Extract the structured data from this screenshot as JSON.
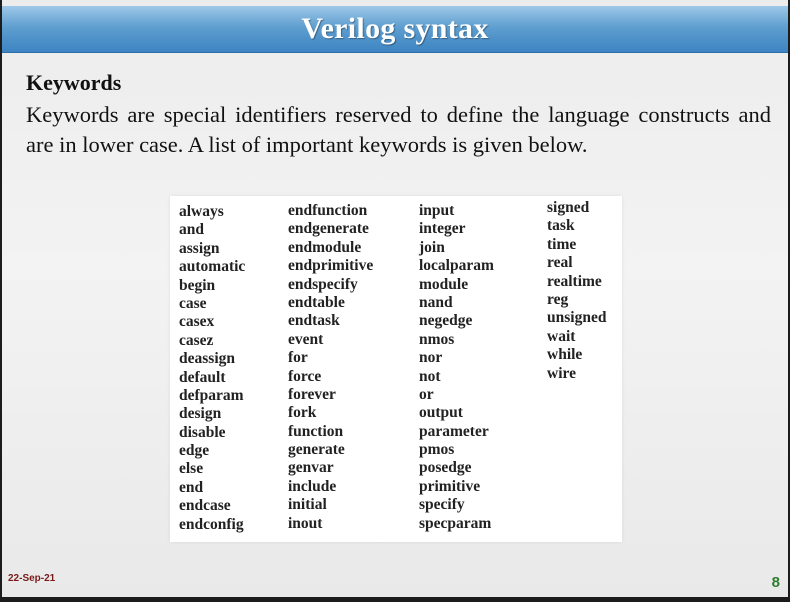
{
  "slide": {
    "title": "Verilog syntax",
    "heading": "Keywords",
    "paragraph": "Keywords are special identifiers reserved to define the language constructs and are in lower case. A list of important keywords is given below.",
    "date": "22-Sep-21",
    "page_number": "8"
  },
  "keywords": {
    "col1": [
      "always",
      "and",
      "assign",
      "automatic",
      "begin",
      "case",
      "casex",
      "casez",
      "deassign",
      "default",
      "defparam",
      "design",
      "disable",
      "edge",
      "else",
      "end",
      "endcase",
      "endconfig"
    ],
    "col2": [
      "endfunction",
      "endgenerate",
      "endmodule",
      "endprimitive",
      "endspecify",
      "endtable",
      "endtask",
      "event",
      "for",
      "force",
      "forever",
      "fork",
      "function",
      "generate",
      "genvar",
      "include",
      "initial",
      "inout"
    ],
    "col3": [
      "input",
      "integer",
      "join",
      "localparam",
      "module",
      "nand",
      "negedge",
      "nmos",
      "nor",
      "not",
      "or",
      "output",
      "parameter",
      "pmos",
      "posedge",
      "primitive",
      "specify",
      "specparam"
    ],
    "col4": [
      "signed",
      "task",
      "time",
      "real",
      "realtime",
      "reg",
      "unsigned",
      "wait",
      "while",
      "wire"
    ]
  },
  "colors": {
    "title_bar": "#4a8fca",
    "date_text": "#7a1a1a",
    "page_number": "#2e7d2e"
  }
}
